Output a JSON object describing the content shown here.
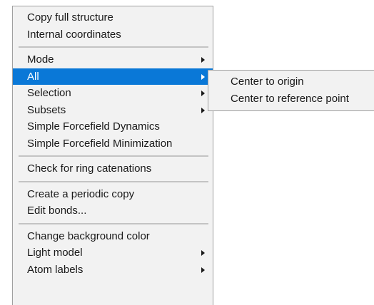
{
  "main_menu": {
    "groups": [
      [
        "Copy full structure",
        "Internal coordinates"
      ],
      [
        "Mode",
        "All",
        "Selection",
        "Subsets",
        "Simple Forcefield Dynamics",
        "Simple Forcefield Minimization"
      ],
      [
        "Check for ring catenations"
      ],
      [
        "Create a periodic copy",
        "Edit bonds..."
      ],
      [
        "Change background color",
        "Light model",
        "Atom labels"
      ]
    ],
    "items": {
      "copy_full_structure": "Copy full structure",
      "internal_coordinates": "Internal coordinates",
      "mode": "Mode",
      "all": "All",
      "selection": "Selection",
      "subsets": "Subsets",
      "simple_forcefield_dynamics": "Simple Forcefield Dynamics",
      "simple_forcefield_minimization": "Simple Forcefield Minimization",
      "check_ring_catenations": "Check for ring catenations",
      "create_periodic_copy": "Create a periodic copy",
      "edit_bonds": "Edit bonds...",
      "change_background_color": "Change background color",
      "light_model": "Light model",
      "atom_labels": "Atom labels"
    },
    "highlighted_item": "All",
    "submenu_items": [
      "Mode",
      "All",
      "Selection",
      "Subsets",
      "Light model",
      "Atom labels"
    ]
  },
  "submenu_all": {
    "items": {
      "center_to_origin": "Center to origin",
      "center_to_reference_point": "Center to reference point"
    }
  },
  "colors": {
    "menu_background": "#f2f2f2",
    "highlight": "#0a78d7",
    "separator": "#c4c4c4",
    "border": "#a0a0a0"
  },
  "icons": [
    "submenu-arrow-icon"
  ]
}
